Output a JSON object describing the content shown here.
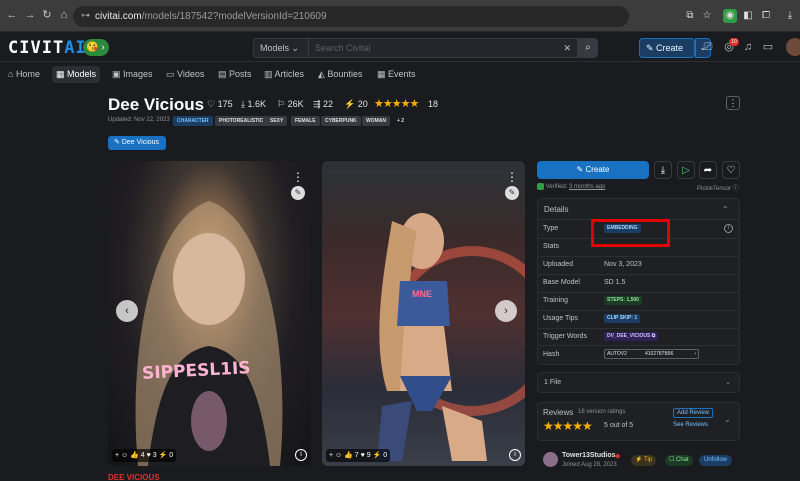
{
  "browser": {
    "url_host": "civitai.com",
    "url_path": "/models/187542?modelVersionId=210609"
  },
  "header": {
    "logo_main": "CIVIT",
    "logo_accent": "AI",
    "search_type": "Models",
    "search_placeholder": "Search Civitai",
    "create_label": "Create",
    "notification_count": "10"
  },
  "nav": {
    "items": [
      "Home",
      "Models",
      "Images",
      "Videos",
      "Posts",
      "Articles",
      "Bounties",
      "Events"
    ]
  },
  "model": {
    "title": "Dee Vicious",
    "likes": "175",
    "downloads": "1.6K",
    "buzz": "26K",
    "comments": "22",
    "tips": "20",
    "rating_count": "18",
    "updated": "Updated: Nov 22, 2023",
    "tags": [
      "CHARACTER",
      "PHOTOREALISTIC",
      "SEXY",
      "FEMALE",
      "CYBERPUNK",
      "WOMAN",
      "+ 2"
    ],
    "version_badge": "Dee Vicious",
    "below_title": "DEE VICIOUS"
  },
  "images": [
    {
      "reactions": "+ ☺   👍 4   ♥ 3   ⚡ 0",
      "overlay_text": "SIPPESL1IS"
    },
    {
      "reactions": "+ ☺   👍 7   ♥ 9   ⚡ 0",
      "overlay_text": "MNE"
    }
  ],
  "panel": {
    "create_label": "Create",
    "verified_text": "Verified:",
    "verified_when": "3 months ago",
    "publisher": "PickleTensor",
    "details_title": "Details",
    "rows": {
      "type_label": "Type",
      "type_value": "EMBEDDING",
      "stats_label": "Stats",
      "uploaded_label": "Uploaded",
      "uploaded_value": "Nov 3, 2023",
      "base_label": "Base Model",
      "base_value": "SD 1.5",
      "training_label": "Training",
      "training_value": "STEPS: 1,500",
      "usage_label": "Usage Tips",
      "usage_value": "CLIP SKIP: 1",
      "trigger_label": "Trigger Words",
      "trigger_value": "DV_DEE_VICIOUS",
      "hash_label": "Hash",
      "hash_algo": "AUTOV2",
      "hash_value": "4102787B96"
    },
    "files_label": "1 File",
    "reviews": {
      "title": "Reviews",
      "subtitle": "18 version ratings",
      "score": "5 out of 5",
      "add_review": "Add Review",
      "see_reviews": "See Reviews"
    },
    "creator": {
      "name": "Tower13Studios",
      "joined": "Joined Aug 28, 2023",
      "tip": "Tip",
      "chat": "Chat",
      "unfollow": "Unfollow"
    }
  }
}
